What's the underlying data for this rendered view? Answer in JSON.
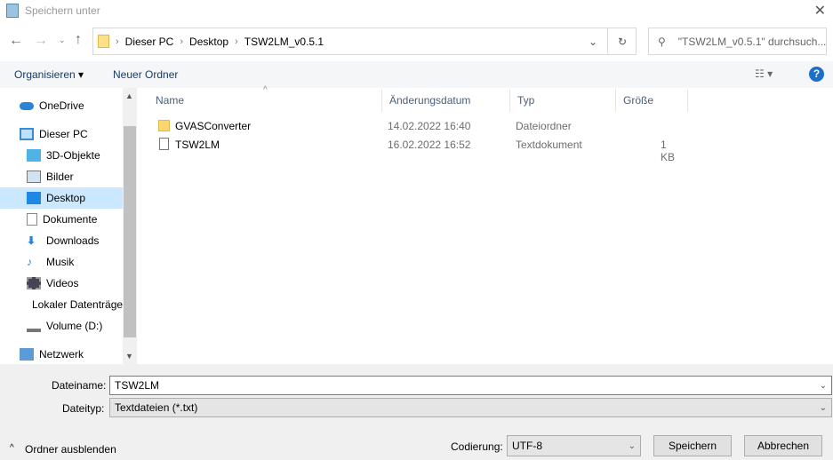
{
  "window": {
    "title": "Speichern unter"
  },
  "address": {
    "crumbs": [
      "Dieser PC",
      "Desktop",
      "TSW2LM_v0.5.1"
    ],
    "search_placeholder": "\"TSW2LM_v0.5.1\" durchsuch..."
  },
  "toolbar": {
    "organize": "Organisieren",
    "new_folder": "Neuer Ordner"
  },
  "sidebar": {
    "items": [
      {
        "label": "OneDrive",
        "icon": "cloud-icon"
      },
      {
        "label": "Dieser PC",
        "icon": "computer-icon"
      },
      {
        "label": "3D-Objekte",
        "icon": "cube-icon"
      },
      {
        "label": "Bilder",
        "icon": "pictures-icon"
      },
      {
        "label": "Desktop",
        "icon": "desktop-icon"
      },
      {
        "label": "Dokumente",
        "icon": "document-icon"
      },
      {
        "label": "Downloads",
        "icon": "download-icon"
      },
      {
        "label": "Musik",
        "icon": "music-icon"
      },
      {
        "label": "Videos",
        "icon": "video-icon"
      },
      {
        "label": "Lokaler Datenträger (C:)",
        "icon": "drive-icon"
      },
      {
        "label": "Volume (D:)",
        "icon": "drive-icon"
      },
      {
        "label": "Netzwerk",
        "icon": "network-icon"
      }
    ]
  },
  "columns": [
    "Name",
    "Änderungsdatum",
    "Typ",
    "Größe"
  ],
  "files": [
    {
      "name": "GVASConverter",
      "date": "14.02.2022 16:40",
      "type": "Dateiordner",
      "size": ""
    },
    {
      "name": "TSW2LM",
      "date": "16.02.2022 16:52",
      "type": "Textdokument",
      "size": "1 KB"
    }
  ],
  "form": {
    "filename_label": "Dateiname:",
    "filename": "TSW2LM",
    "filetype_label": "Dateityp:",
    "filetype": "Textdateien (*.txt)",
    "encoding_label": "Codierung:",
    "encoding": "UTF-8",
    "hide_folders": "Ordner ausblenden",
    "save": "Speichern",
    "cancel": "Abbrechen"
  }
}
